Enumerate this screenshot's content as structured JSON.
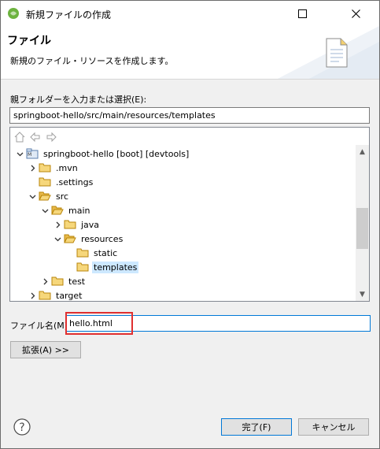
{
  "window": {
    "title": "新規ファイルの作成",
    "maximize_icon": "maximize-icon",
    "close_icon": "close-icon"
  },
  "banner": {
    "title": "ファイル",
    "description": "新規のファイル・リソースを作成します。"
  },
  "parent_folder": {
    "label": "親フォルダーを入力または選択(E):",
    "value": "springboot-hello/src/main/resources/templates"
  },
  "tree": {
    "toolbar_icons": [
      "home-icon",
      "back-icon",
      "forward-icon"
    ],
    "items": [
      {
        "label": "springboot-hello [boot] [devtools]",
        "expanded": true,
        "type": "project"
      },
      {
        "label": ".mvn",
        "expanded": false,
        "type": "folder"
      },
      {
        "label": ".settings",
        "expanded": null,
        "type": "folder"
      },
      {
        "label": "src",
        "expanded": true,
        "type": "folder"
      },
      {
        "label": "main",
        "expanded": true,
        "type": "folder"
      },
      {
        "label": "java",
        "expanded": false,
        "type": "folder"
      },
      {
        "label": "resources",
        "expanded": true,
        "type": "folder"
      },
      {
        "label": "static",
        "expanded": null,
        "type": "folder"
      },
      {
        "label": "templates",
        "expanded": null,
        "type": "folder",
        "selected": true
      },
      {
        "label": "test",
        "expanded": false,
        "type": "folder"
      },
      {
        "label": "target",
        "expanded": false,
        "type": "folder"
      }
    ]
  },
  "file_name": {
    "label": "ファイル名(M):",
    "value": "hello.html"
  },
  "buttons": {
    "advanced": "拡張(A) >>",
    "finish": "完了(F)",
    "cancel": "キャンセル"
  },
  "colors": {
    "selection": "#cde8ff",
    "highlight": "#e03030",
    "focus": "#0078d7"
  }
}
